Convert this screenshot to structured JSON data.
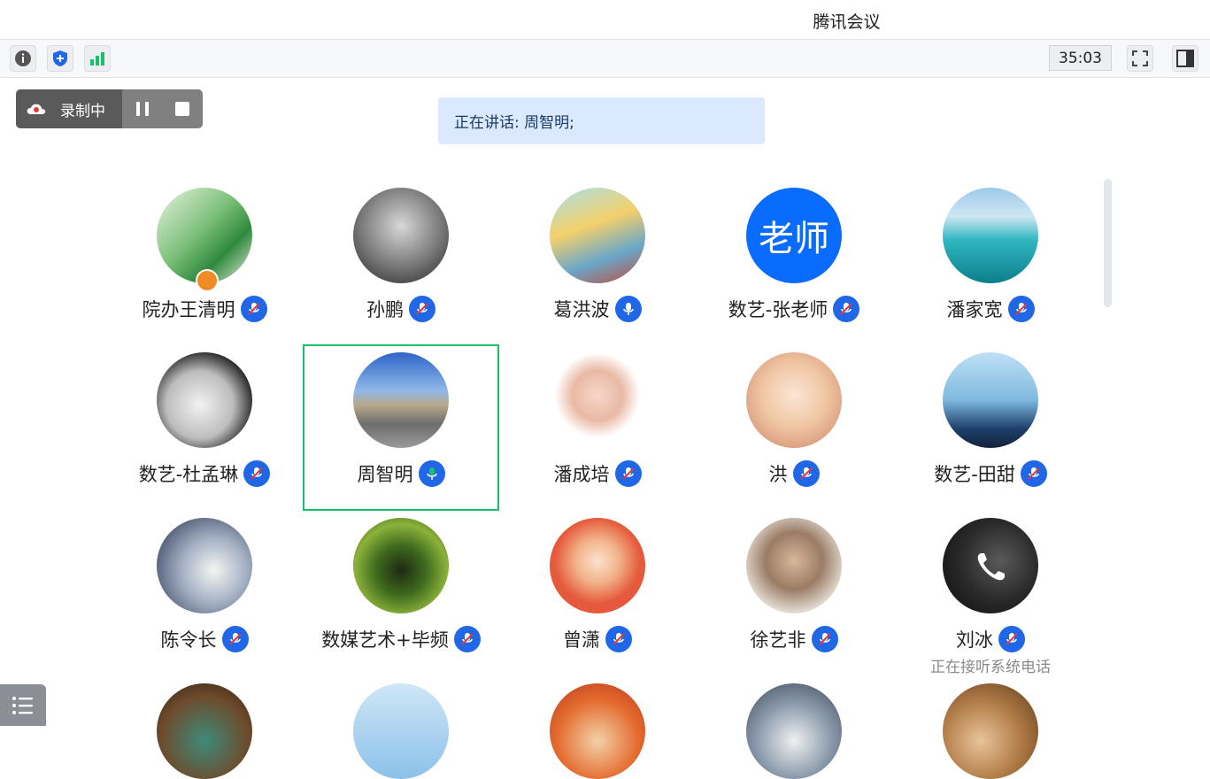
{
  "app": {
    "title": "腾讯会议"
  },
  "toolbar": {
    "timer": "35:03"
  },
  "recording": {
    "label": "录制中"
  },
  "speaking": {
    "text": "正在讲话: 周智明;"
  },
  "participants": [
    {
      "name": "院办王清明",
      "mic": "muted"
    },
    {
      "name": "孙鹏",
      "mic": "muted"
    },
    {
      "name": "葛洪波",
      "mic": "on"
    },
    {
      "name": "数艺-张老师",
      "mic": "muted",
      "avatar_text": "老师"
    },
    {
      "name": "潘家宽",
      "mic": "muted"
    },
    {
      "name": "数艺-杜孟琳",
      "mic": "muted"
    },
    {
      "name": "周智明",
      "mic": "speaking"
    },
    {
      "name": "潘成培",
      "mic": "muted"
    },
    {
      "name": "洪",
      "mic": "muted"
    },
    {
      "name": "数艺-田甜",
      "mic": "muted"
    },
    {
      "name": "陈令长",
      "mic": "muted"
    },
    {
      "name": "数媒艺术+毕频",
      "mic": "muted"
    },
    {
      "name": "曾潇",
      "mic": "muted"
    },
    {
      "name": "徐艺非",
      "mic": "muted"
    },
    {
      "name": "刘冰",
      "mic": "muted",
      "status": "正在接听系统电话"
    }
  ],
  "colors": {
    "accent": "#1f67e6",
    "speaking_border": "#18c06c",
    "speaking_mic": "#18c06c"
  }
}
